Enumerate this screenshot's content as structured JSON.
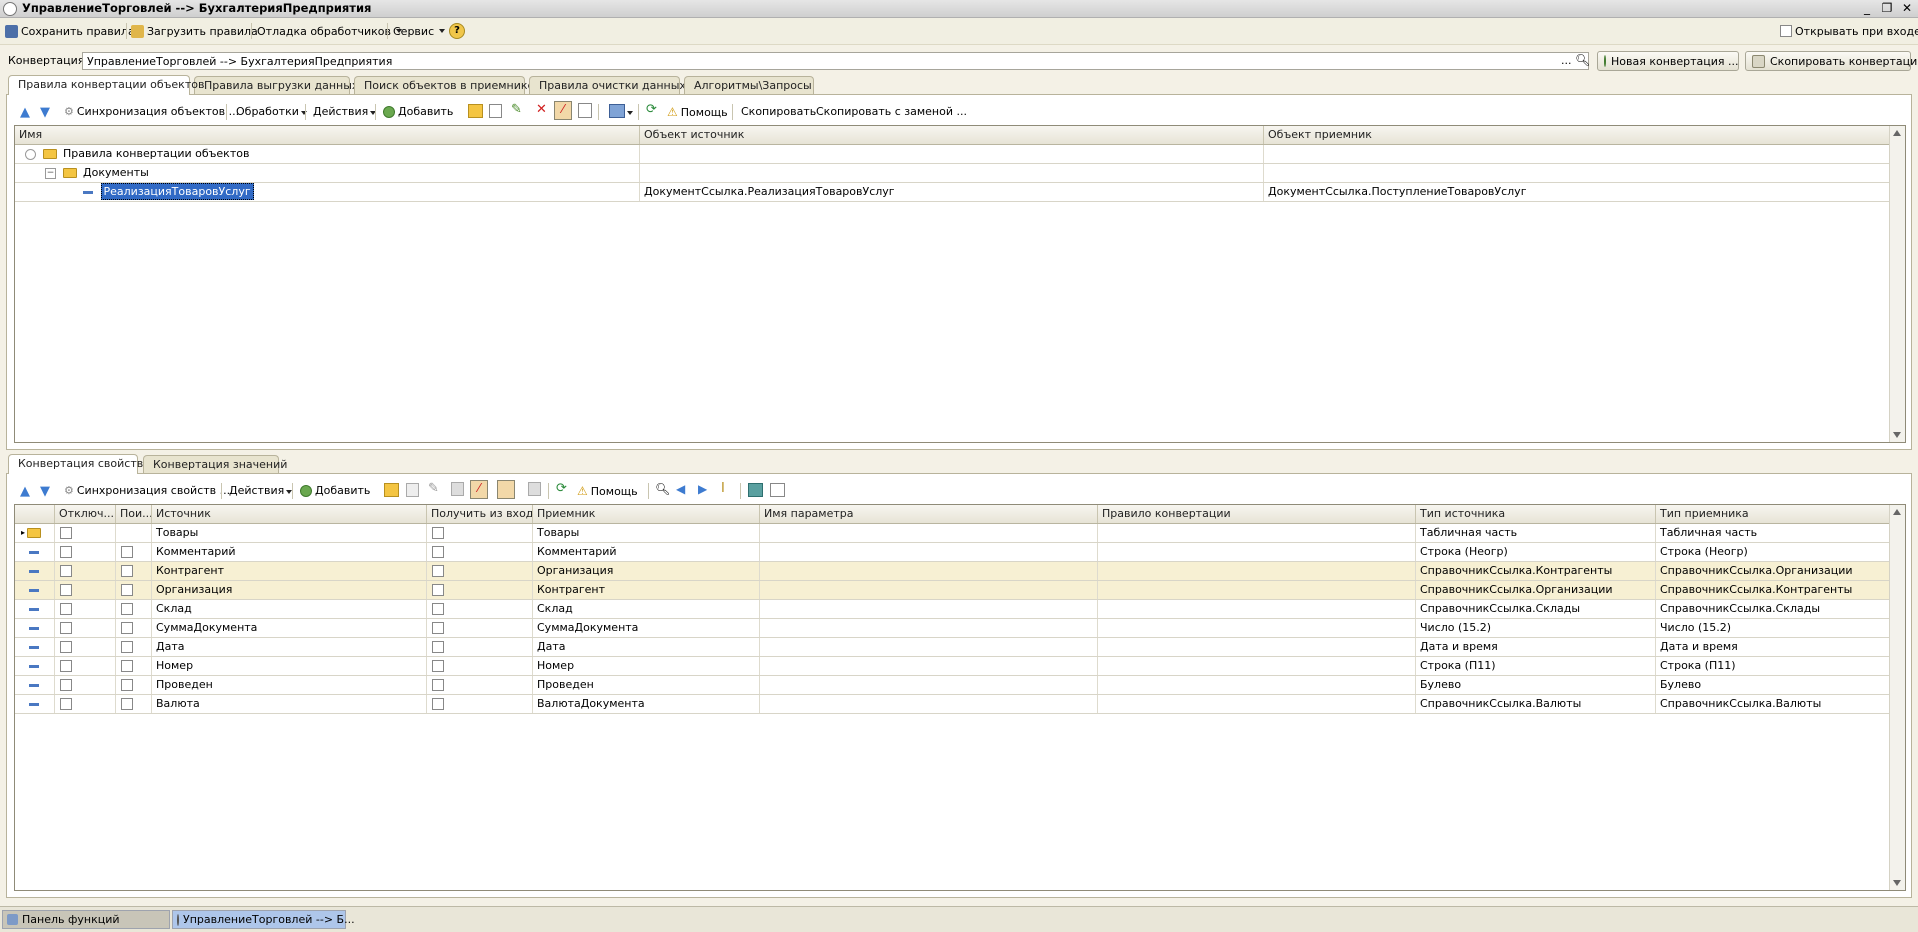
{
  "window": {
    "title": "УправлениеТорговлей --> БухгалтерияПредприятия"
  },
  "toolbar": {
    "save": "Сохранить правила",
    "load": "Загрузить правила",
    "debug": "Отладка обработчиков",
    "service": "Сервис",
    "help": "?",
    "open_on_start": "Открывать при входе"
  },
  "conversion": {
    "label": "Конвертация:",
    "value": "УправлениеТорговлей --> БухгалтерияПредприятия",
    "dots": "...",
    "new_btn": "Новая конвертация ...",
    "copy_btn": "Скопировать конвертацию"
  },
  "top_tabs": [
    "Правила конвертации объектов",
    "Правила выгрузки данных",
    "Поиск объектов в приемнике",
    "Правила очистки данных",
    "Алгоритмы\\Запросы"
  ],
  "top_toolbar": {
    "sync": "Синхронизация объектов ...",
    "processing": "Обработки",
    "actions": "Действия",
    "add": "Добавить",
    "help": "Помощь",
    "copy": "Скопировать",
    "copy_replace": "Скопировать с заменой ..."
  },
  "top_grid": {
    "headers": [
      "Имя",
      "Объект источник",
      "Объект приемник"
    ],
    "rows": [
      {
        "name": "Правила конвертации объектов",
        "source": "",
        "target": ""
      },
      {
        "name": "Документы",
        "source": "",
        "target": ""
      },
      {
        "name": "РеализацияТоваровУслуг",
        "source": "ДокументСсылка.РеализацияТоваровУслуг",
        "target": "ДокументСсылка.ПоступлениеТоваровУслуг"
      }
    ]
  },
  "bottom_tabs": [
    "Конвертация свойств",
    "Конвертация значений"
  ],
  "bottom_toolbar": {
    "sync": "Синхронизация свойств ...",
    "actions": "Действия",
    "add": "Добавить",
    "help": "Помощь"
  },
  "bottom_grid": {
    "headers": [
      "Отключ...",
      "Пои...",
      "Источник",
      "Получить из входя...",
      "Приемник",
      "Имя параметра",
      "Правило конвертации",
      "Тип источника",
      "Тип приемника"
    ],
    "rows": [
      {
        "src": "Товары",
        "dst": "Товары",
        "src_type": "Табличная часть",
        "dst_type": "Табличная часть"
      },
      {
        "src": "Комментарий",
        "dst": "Комментарий",
        "src_type": "Строка (Неогр)",
        "dst_type": "Строка (Неогр)"
      },
      {
        "src": "Контрагент",
        "dst": "Организация",
        "src_type": "СправочникСсылка.Контрагенты",
        "dst_type": "СправочникСсылка.Организации"
      },
      {
        "src": "Организация",
        "dst": "Контрагент",
        "src_type": "СправочникСсылка.Организации",
        "dst_type": "СправочникСсылка.Контрагенты"
      },
      {
        "src": "Склад",
        "dst": "Склад",
        "src_type": "СправочникСсылка.Склады",
        "dst_type": "СправочникСсылка.Склады"
      },
      {
        "src": "СуммаДокумента",
        "dst": "СуммаДокумента",
        "src_type": "Число (15.2)",
        "dst_type": "Число (15.2)"
      },
      {
        "src": "Дата",
        "dst": "Дата",
        "src_type": "Дата и время",
        "dst_type": "Дата и время"
      },
      {
        "src": "Номер",
        "dst": "Номер",
        "src_type": "Строка (П11)",
        "dst_type": "Строка (П11)"
      },
      {
        "src": "Проведен",
        "dst": "Проведен",
        "src_type": "Булево",
        "dst_type": "Булево"
      },
      {
        "src": "Валюта",
        "dst": "ВалютаДокумента",
        "src_type": "СправочникСсылка.Валюты",
        "dst_type": "СправочникСсылка.Валюты"
      }
    ]
  },
  "taskbar": {
    "panel": "Панель функций",
    "window": "УправлениеТорговлей --> Б..."
  },
  "colors": {
    "highlight_row": "#f7f0d3",
    "selection": "#316ac5",
    "accent_green": "#6aa84f"
  }
}
